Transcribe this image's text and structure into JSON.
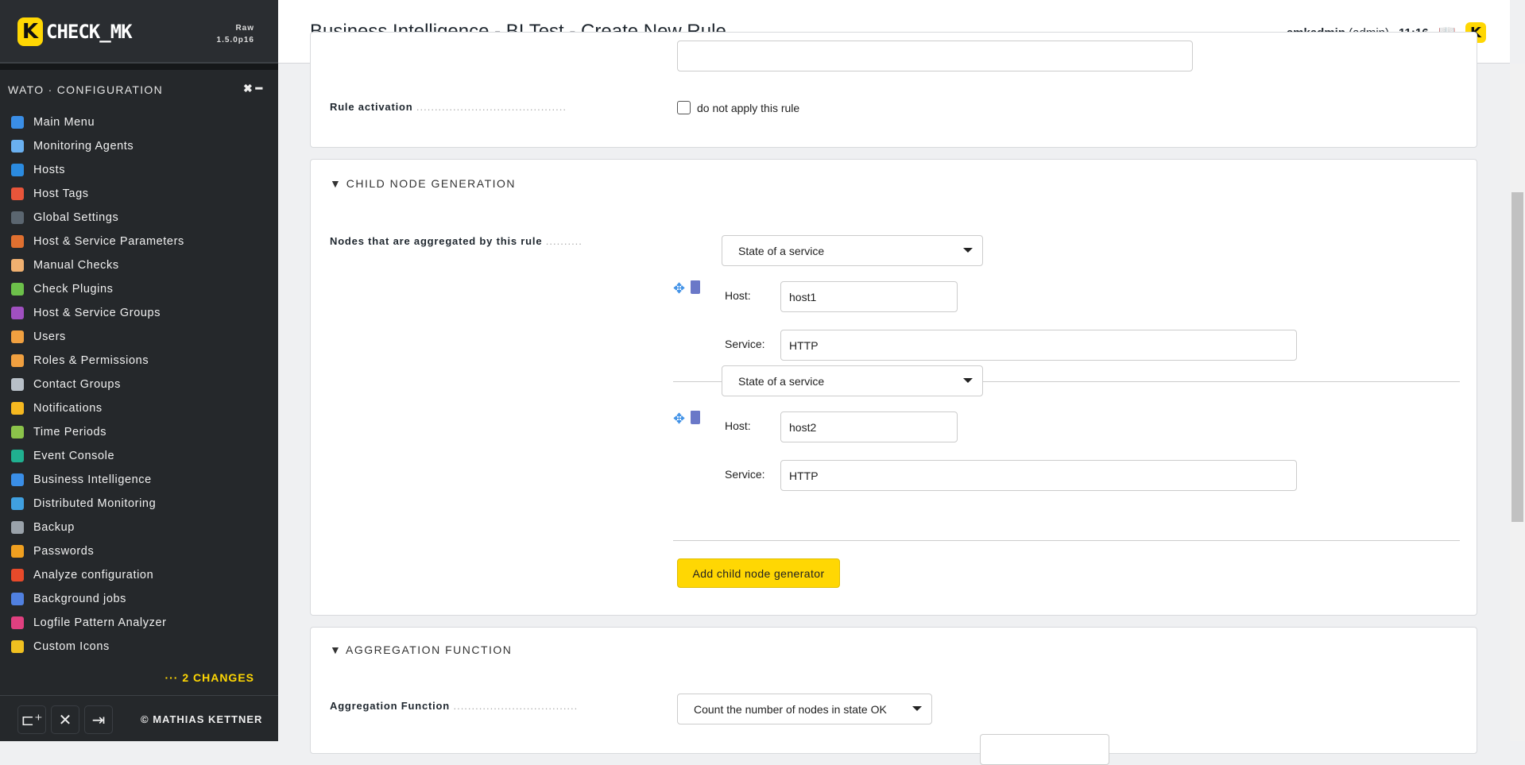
{
  "sidebar": {
    "brand": "CHECK_MK",
    "edition": "Raw",
    "version": "1.5.0p16",
    "snapin_title": "WATO · CONFIGURATION",
    "items": [
      {
        "label": "Main Menu",
        "icon": "home-icon",
        "color": "#3a8ee6"
      },
      {
        "label": "Monitoring Agents",
        "icon": "agent-file-icon",
        "color": "#6ab0f0"
      },
      {
        "label": "Hosts",
        "icon": "server-icon",
        "color": "#2b8be0"
      },
      {
        "label": "Host Tags",
        "icon": "tag-icon",
        "color": "#e8553a"
      },
      {
        "label": "Global Settings",
        "icon": "gear-icon",
        "color": "#5b6670"
      },
      {
        "label": "Host & Service Parameters",
        "icon": "sliders-icon",
        "color": "#e07030"
      },
      {
        "label": "Manual Checks",
        "icon": "hand-icon",
        "color": "#f0b070"
      },
      {
        "label": "Check Plugins",
        "icon": "puzzle-icon",
        "color": "#6cc04a"
      },
      {
        "label": "Host & Service Groups",
        "icon": "groups-icon",
        "color": "#a050c0"
      },
      {
        "label": "Users",
        "icon": "users-icon",
        "color": "#f0a040"
      },
      {
        "label": "Roles & Permissions",
        "icon": "role-icon",
        "color": "#f0a040"
      },
      {
        "label": "Contact Groups",
        "icon": "contact-card-icon",
        "color": "#b8c0c8"
      },
      {
        "label": "Notifications",
        "icon": "bell-icon",
        "color": "#f5b820"
      },
      {
        "label": "Time Periods",
        "icon": "clock-icon",
        "color": "#8bc34a"
      },
      {
        "label": "Event Console",
        "icon": "event-icon",
        "color": "#20b090"
      },
      {
        "label": "Business Intelligence",
        "icon": "bi-tree-icon",
        "color": "#3a8ee6"
      },
      {
        "label": "Distributed Monitoring",
        "icon": "globe-icon",
        "color": "#40a0e0"
      },
      {
        "label": "Backup",
        "icon": "tape-icon",
        "color": "#9aa2aa"
      },
      {
        "label": "Passwords",
        "icon": "key-icon",
        "color": "#f0a020"
      },
      {
        "label": "Analyze configuration",
        "icon": "heart-check-icon",
        "color": "#e84a2a"
      },
      {
        "label": "Background jobs",
        "icon": "list-icon",
        "color": "#5080e0"
      },
      {
        "label": "Logfile Pattern Analyzer",
        "icon": "flask-icon",
        "color": "#e04080"
      },
      {
        "label": "Custom Icons",
        "icon": "icons-grid-icon",
        "color": "#f0c020"
      }
    ],
    "changes": "··· 2 CHANGES",
    "copyright": "© MATHIAS KETTNER"
  },
  "header": {
    "title": "Business Intelligence - BI Test - Create New Rule",
    "user": "cmkadmin",
    "role": "(admin)",
    "time": "11:16"
  },
  "form": {
    "rule_activation": {
      "label": "Rule activation",
      "checkbox_label": "do not apply this rule",
      "checked": false
    },
    "child_section": "CHILD NODE GENERATION",
    "nodes_label": "Nodes that are aggregated by this rule",
    "nodes": [
      {
        "type": "State of a service",
        "host_label": "Host:",
        "host": "host1",
        "service_label": "Service:",
        "service": "HTTP"
      },
      {
        "type": "State of a service",
        "host_label": "Host:",
        "host": "host2",
        "service_label": "Service:",
        "service": "HTTP"
      }
    ],
    "add_button": "Add child node generator",
    "agg_section": "AGGREGATION FUNCTION",
    "agg_label": "Aggregation Function",
    "agg_value": "Count the number of nodes in state OK"
  },
  "colors": {
    "accent": "#ffd703",
    "sidebar_bg": "#25282b"
  }
}
